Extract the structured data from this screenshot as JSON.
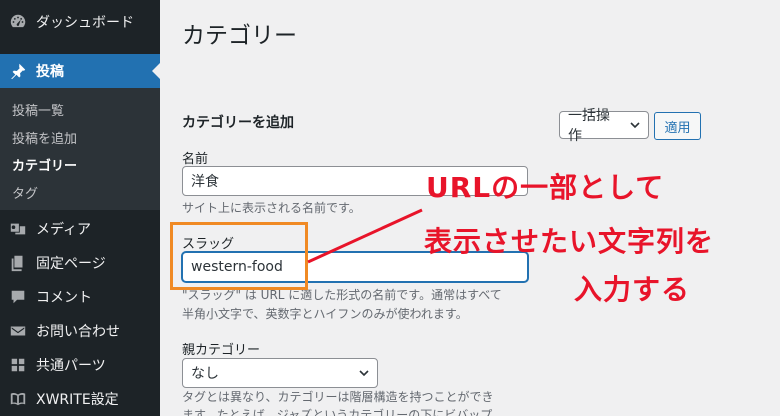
{
  "sidebar": {
    "items": [
      {
        "label": "ダッシュボード",
        "icon": "dashboard-icon"
      },
      {
        "label": "投稿",
        "icon": "pin-icon",
        "active": true
      },
      {
        "label": "メディア",
        "icon": "media-icon"
      },
      {
        "label": "固定ページ",
        "icon": "page-icon"
      },
      {
        "label": "コメント",
        "icon": "comment-icon"
      },
      {
        "label": "お問い合わせ",
        "icon": "mail-icon"
      },
      {
        "label": "共通パーツ",
        "icon": "parts-icon"
      },
      {
        "label": "XWRITE設定",
        "icon": "book-icon"
      }
    ],
    "submenu": [
      {
        "label": "投稿一覧"
      },
      {
        "label": "投稿を追加"
      },
      {
        "label": "カテゴリー",
        "current": true
      },
      {
        "label": "タグ"
      }
    ]
  },
  "main": {
    "title": "カテゴリー",
    "form_heading": "カテゴリーを追加",
    "name": {
      "label": "名前",
      "value": "洋食",
      "help": "サイト上に表示される名前です。"
    },
    "slug": {
      "label": "スラッグ",
      "value": "western-food",
      "help_line1": "\"スラッグ\" は URL に適した形式の名前です。通常はすべて",
      "help_line2": "半角小文字で、英数字とハイフンのみが使われます。"
    },
    "parent": {
      "label": "親カテゴリー",
      "selected": "なし",
      "help_line1": "タグとは異なり、カテゴリーは階層構造を持つことができ",
      "help_line2": "ます。たとえば、ジャズというカテゴリーの下にビバップ"
    },
    "bulk_action": {
      "selected": "一括操作",
      "apply_label": "適用"
    }
  },
  "annotation": {
    "line1": "URLの一部として",
    "line2": "表示させたい文字列を",
    "line3": "入力する",
    "color": "#e8142a",
    "box_color": "#f08a24"
  },
  "colors": {
    "sidebar_bg": "#1d2327",
    "accent": "#2271b1",
    "page_bg": "#f0f0f1"
  }
}
